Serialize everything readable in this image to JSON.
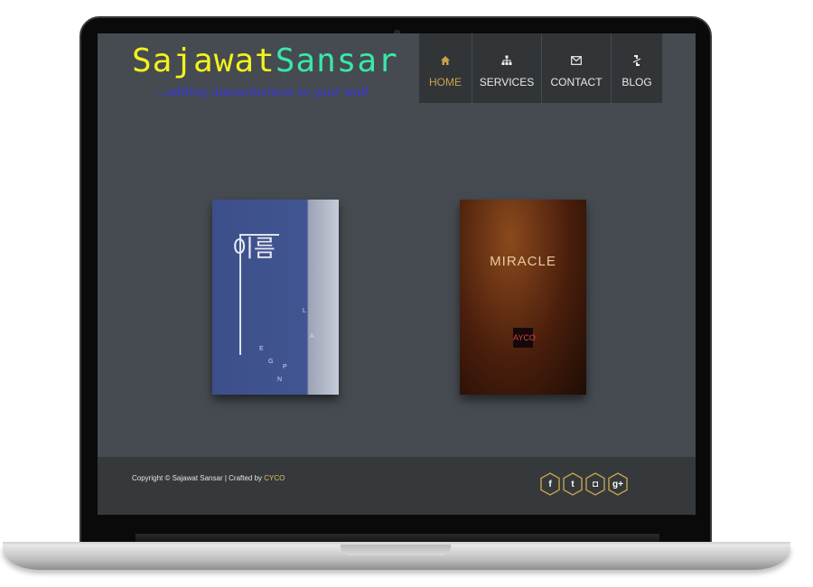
{
  "brand": {
    "name_part1": "Sajawat",
    "name_part2": "Sansar",
    "tagline": "...adding Awesomeness to your wall"
  },
  "nav": [
    {
      "label": "HOME",
      "icon": "home-icon",
      "active": true
    },
    {
      "label": "SERVICES",
      "icon": "sitemap-icon",
      "active": false
    },
    {
      "label": "CONTACT",
      "icon": "envelope-icon",
      "active": false
    },
    {
      "label": "BLOG",
      "icon": "link-icon",
      "active": false
    }
  ],
  "covers": {
    "right_title": "MIRACLE",
    "right_badge": "AYCO",
    "left_hangul": "이름"
  },
  "footer": {
    "copyright_prefix": "Copyright © Sajawat Sansar | Crafted by ",
    "copyright_link": "CYCO",
    "social": [
      {
        "icon": "facebook-icon",
        "glyph": "f"
      },
      {
        "icon": "twitter-icon",
        "glyph": "t"
      },
      {
        "icon": "instagram-icon",
        "glyph": "◘"
      },
      {
        "icon": "google-plus-icon",
        "glyph": "g+"
      }
    ]
  },
  "colors": {
    "screen_bg": "#454b50",
    "nav_bg": "#313538",
    "active_accent": "#c8a24a",
    "logo_yellow": "#f3f21b",
    "logo_green": "#39e8a8",
    "tagline_blue": "#3b36f0",
    "hex_border": "#c8a24a"
  }
}
